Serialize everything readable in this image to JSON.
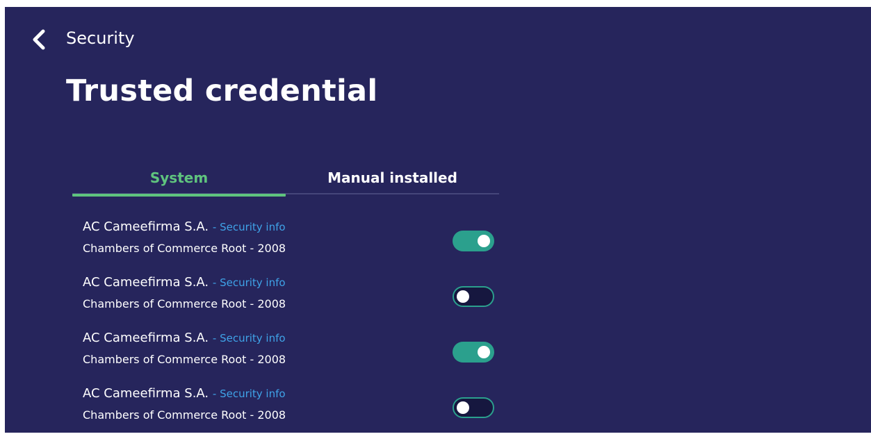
{
  "header": {
    "back_icon": "chevron-left-icon",
    "breadcrumb": "Security",
    "title": "Trusted credential"
  },
  "tabs": [
    {
      "label": "System",
      "active": true
    },
    {
      "label": "Manual installed",
      "active": false
    }
  ],
  "certificates": [
    {
      "name": "AC Cameefirma S.A.",
      "link": "- Security info",
      "subtitle": "Chambers of Commerce Root - 2008",
      "enabled": true
    },
    {
      "name": "AC Cameefirma S.A.",
      "link": "- Security info",
      "subtitle": "Chambers of Commerce Root - 2008",
      "enabled": false
    },
    {
      "name": "AC Cameefirma S.A.",
      "link": "- Security info",
      "subtitle": "Chambers of Commerce Root - 2008",
      "enabled": true
    },
    {
      "name": "AC Cameefirma S.A.",
      "link": "- Security info",
      "subtitle": "Chambers of Commerce Root - 2008",
      "enabled": false
    }
  ],
  "colors": {
    "background": "#26255c",
    "accent_green": "#5fc47e",
    "toggle_on": "#2ba08d",
    "link": "#3fa3e8"
  }
}
